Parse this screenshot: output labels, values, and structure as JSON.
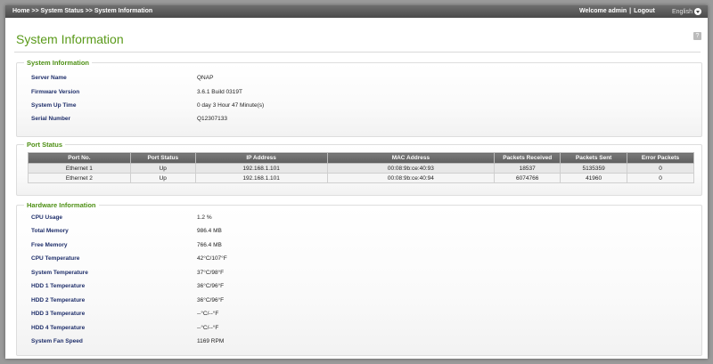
{
  "topbar": {
    "breadcrumb": "Home >> System Status >> System Information",
    "welcome": "Welcome admin",
    "separator": "|",
    "logout": "Logout",
    "language": "English"
  },
  "page": {
    "title": "System Information",
    "help_label": "?"
  },
  "system_info": {
    "legend": "System Information",
    "rows": [
      {
        "label": "Server Name",
        "value": "QNAP"
      },
      {
        "label": "Firmware Version",
        "value": "3.6.1 Build 0319T"
      },
      {
        "label": "System Up Time",
        "value": "0 day 3 Hour 47 Minute(s)"
      },
      {
        "label": "Serial Number",
        "value": "Q12307133"
      }
    ]
  },
  "port_status": {
    "legend": "Port Status",
    "columns": [
      "Port No.",
      "Port Status",
      "IP Address",
      "MAC Address",
      "Packets Received",
      "Packets Sent",
      "Error Packets"
    ],
    "rows": [
      [
        "Ethernet 1",
        "Up",
        "192.168.1.101",
        "00:08:9b:ce:40:93",
        "18537",
        "5135359",
        "0"
      ],
      [
        "Ethernet 2",
        "Up",
        "192.168.1.101",
        "00:08:9b:ce:40:94",
        "6074766",
        "41960",
        "0"
      ]
    ]
  },
  "hardware_info": {
    "legend": "Hardware Information",
    "rows": [
      {
        "label": "CPU Usage",
        "value": "1.2 %"
      },
      {
        "label": "Total Memory",
        "value": "986.4 MB"
      },
      {
        "label": "Free Memory",
        "value": "766.4 MB"
      },
      {
        "label": "CPU Temperature",
        "value": "42°C/107°F"
      },
      {
        "label": "System Temperature",
        "value": "37°C/98°F"
      },
      {
        "label": "HDD 1 Temperature",
        "value": "36°C/96°F"
      },
      {
        "label": "HDD 2 Temperature",
        "value": "36°C/96°F"
      },
      {
        "label": "HDD 3 Temperature",
        "value": "--°C/--°F"
      },
      {
        "label": "HDD 4 Temperature",
        "value": "--°C/--°F"
      },
      {
        "label": "System Fan Speed",
        "value": "1169 RPM"
      }
    ]
  },
  "colors": {
    "accent": "#5a9a1a",
    "label": "#1e2e6a",
    "header_bar": "#5e5e5e"
  },
  "icons": {
    "help": "help-icon",
    "language_dropdown": "chevron-down-icon"
  }
}
